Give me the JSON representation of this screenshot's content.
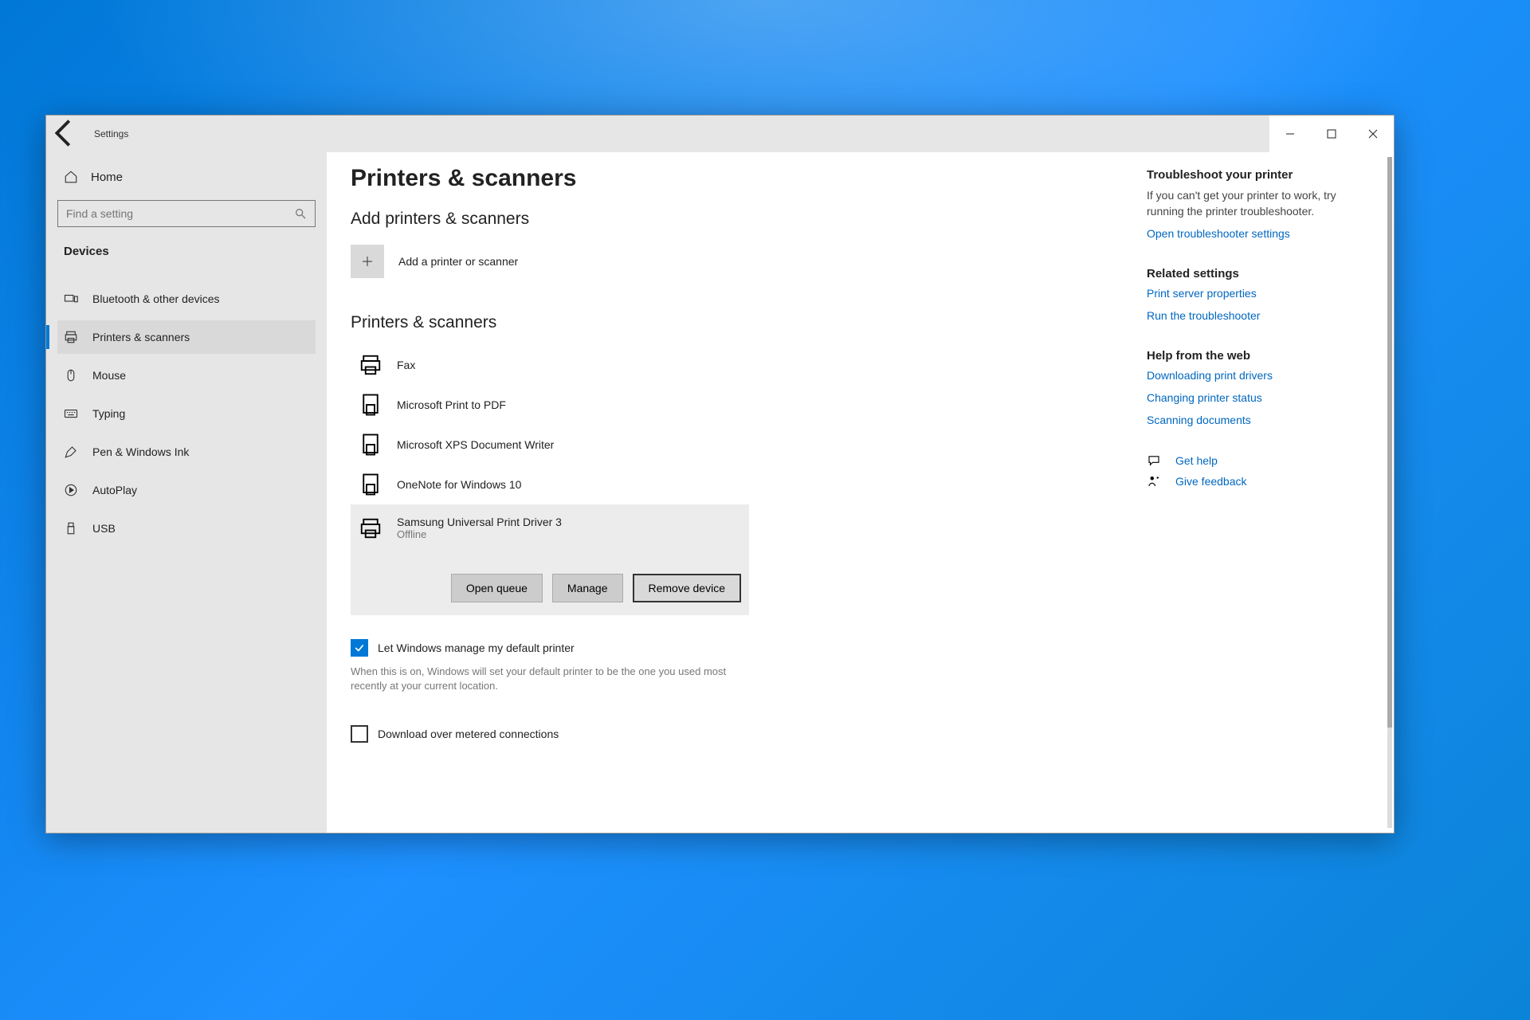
{
  "titlebar": {
    "app_name": "Settings"
  },
  "sidebar": {
    "home": "Home",
    "search_placeholder": "Find a setting",
    "category": "Devices",
    "items": [
      "Bluetooth & other devices",
      "Printers & scanners",
      "Mouse",
      "Typing",
      "Pen & Windows Ink",
      "AutoPlay",
      "USB"
    ]
  },
  "main": {
    "title": "Printers & scanners",
    "add_heading": "Add printers & scanners",
    "add_label": "Add a printer or scanner",
    "list_heading": "Printers & scanners",
    "printers": [
      {
        "name": "Fax"
      },
      {
        "name": "Microsoft Print to PDF"
      },
      {
        "name": "Microsoft XPS Document Writer"
      },
      {
        "name": "OneNote for Windows 10"
      },
      {
        "name": "Samsung Universal Print Driver 3",
        "status": "Offline"
      }
    ],
    "btn_open_queue": "Open queue",
    "btn_manage": "Manage",
    "btn_remove": "Remove device",
    "cb1_label": "Let Windows manage my default printer",
    "cb1_helper": "When this is on, Windows will set your default printer to be the one you used most recently at your current location.",
    "cb2_label": "Download over metered connections"
  },
  "side": {
    "troubleshoot_head": "Troubleshoot your printer",
    "troubleshoot_text": "If you can't get your printer to work, try running the printer troubleshooter.",
    "troubleshoot_link": "Open troubleshooter settings",
    "related_head": "Related settings",
    "related_links": [
      "Print server properties",
      "Run the troubleshooter"
    ],
    "webhelp_head": "Help from the web",
    "webhelp_links": [
      "Downloading print drivers",
      "Changing printer status",
      "Scanning documents"
    ],
    "get_help": "Get help",
    "give_feedback": "Give feedback"
  }
}
